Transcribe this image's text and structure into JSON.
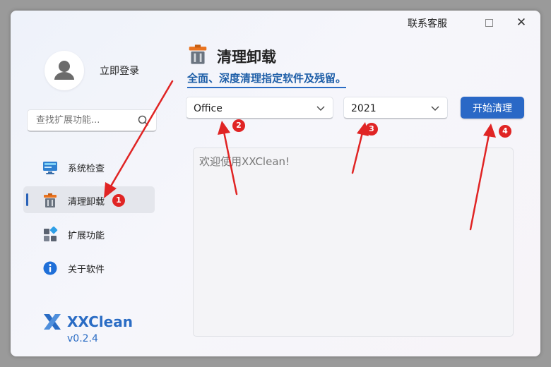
{
  "titlebar": {
    "contact": "联系客服"
  },
  "sidebar": {
    "login": "立即登录",
    "search_placeholder": "查找扩展功能...",
    "items": [
      {
        "label": "系统检查",
        "icon": "system-check-icon",
        "active": false
      },
      {
        "label": "清理卸载",
        "icon": "trash-icon",
        "active": true
      },
      {
        "label": "扩展功能",
        "icon": "extensions-icon",
        "active": false
      },
      {
        "label": "关于软件",
        "icon": "info-icon",
        "active": false
      }
    ],
    "brand": {
      "name": "XXClean",
      "version": "v0.2.4"
    }
  },
  "main": {
    "title": "清理卸载",
    "subtitle": "全面、深度清理指定软件及残留。",
    "product_select": "Office",
    "version_select": "2021",
    "start_button": "开始清理",
    "log_text": "欢迎使用XXClean!"
  },
  "annotations": [
    "1",
    "2",
    "3",
    "4"
  ],
  "colors": {
    "accent": "#2a68c6",
    "annotation": "#e02424"
  }
}
